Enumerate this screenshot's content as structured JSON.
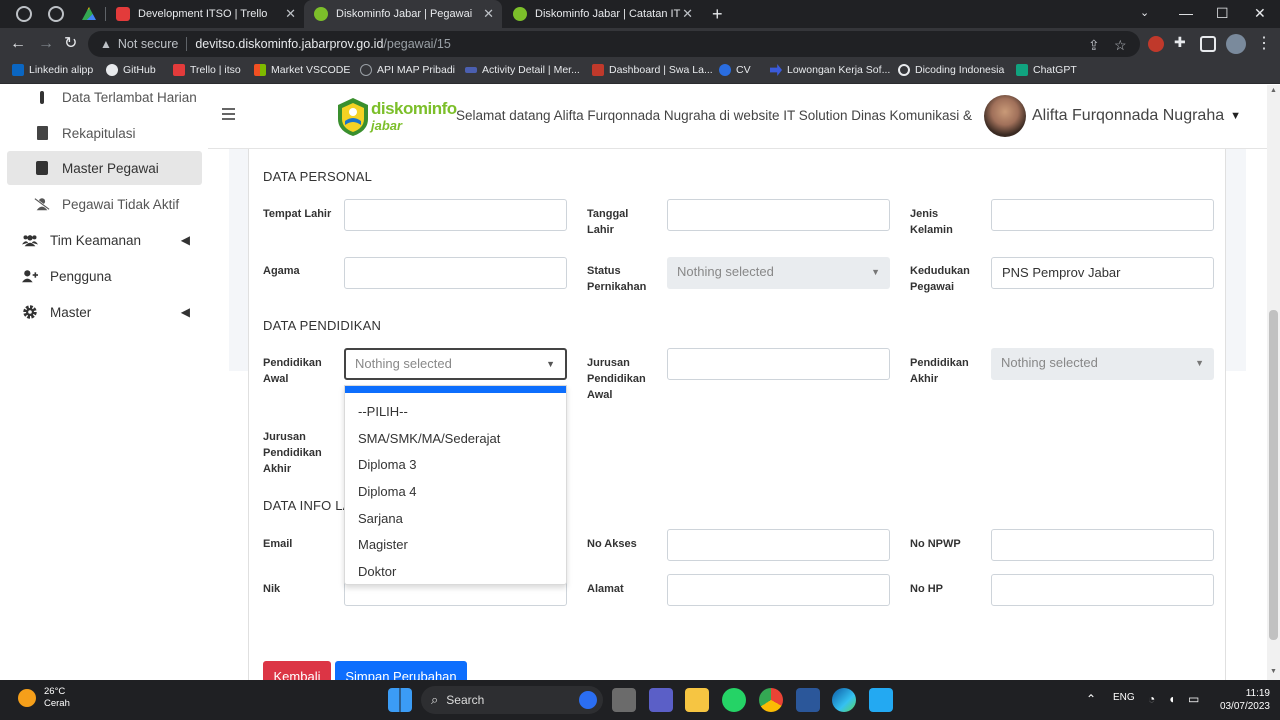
{
  "browser": {
    "tabs": [
      {
        "title": "Development ITSO | Trello",
        "active": false
      },
      {
        "title": "Diskominfo Jabar | Pegawai",
        "active": true
      },
      {
        "title": "Diskominfo Jabar | Catatan IT",
        "active": false
      }
    ],
    "security_label": "Not secure",
    "url_host": "devitso.diskominfo.jabarprov.go.id",
    "url_path": "/pegawai/15",
    "bookmarks": [
      "Linkedin alipp",
      "GitHub",
      "Trello | itso",
      "Market VSCODE",
      "API MAP Pribadi",
      "Activity Detail | Mer...",
      "Dashboard | Swa La...",
      "CV",
      "Lowongan Kerja Sof...",
      "Dicoding Indonesia",
      "ChatGPT"
    ]
  },
  "sidebar": {
    "items": [
      {
        "label": "Data Terlambat Harian",
        "icon": "exclamation-icon"
      },
      {
        "label": "Rekapitulasi",
        "icon": "file-icon"
      },
      {
        "label": "Master Pegawai",
        "icon": "id-card-icon"
      },
      {
        "label": "Pegawai Tidak Aktif",
        "icon": "user-slash-icon"
      },
      {
        "label": "Tim Keamanan",
        "icon": "users-icon"
      },
      {
        "label": "Pengguna",
        "icon": "user-plus-icon"
      },
      {
        "label": "Master",
        "icon": "gear-icon"
      }
    ]
  },
  "header": {
    "logo_text_top": "diskominfo",
    "logo_text_bottom": "jabar",
    "welcome": "Selamat datang Alifta Furqonnada Nugraha di website IT Solution Dinas Komunikasi & In",
    "user_name": "Alifta Furqonnada Nugraha"
  },
  "form": {
    "personal": {
      "title": "DATA PERSONAL",
      "tempat_lahir_label": "Tempat Lahir",
      "tanggal_lahir_label": "Tanggal Lahir",
      "jenis_kelamin_label": "Jenis Kelamin",
      "agama_label": "Agama",
      "status_pernikahan_label": "Status Pernikahan",
      "status_pernikahan_value": "Nothing selected",
      "kedudukan_label": "Kedudukan Pegawai",
      "kedudukan_value": "PNS Pemprov Jabar"
    },
    "pendidikan": {
      "title": "DATA PENDIDIKAN",
      "awal_label": "Pendidikan Awal",
      "awal_value": "Nothing selected",
      "jurusan_awal_label": "Jurusan Pendidikan Awal",
      "akhir_label": "Pendidikan Akhir",
      "akhir_value": "Nothing selected",
      "jurusan_akhir_label": "Jurusan Pendidikan Akhir",
      "options": [
        "--PILIH--",
        "SMA/SMK/MA/Sederajat",
        "Diploma 3",
        "Diploma 4",
        "Sarjana",
        "Magister",
        "Doktor"
      ]
    },
    "info": {
      "title": "DATA INFO LA",
      "email_label": "Email",
      "no_akses_label": "No Akses",
      "no_npwp_label": "No NPWP",
      "nik_label": "Nik",
      "alamat_label": "Alamat",
      "no_hp_label": "No HP"
    },
    "buttons": {
      "back": "Kembali",
      "save": "Simpan Perubahan"
    }
  },
  "taskbar": {
    "temperature": "26°C",
    "weather": "Cerah",
    "search": "Search",
    "language": "ENG",
    "time": "11:19",
    "date": "03/07/2023"
  },
  "colors": {
    "primary": "#0d6efd",
    "danger": "#dc3545",
    "logo_green": "#7cbf2a",
    "logo_blue": "#1a73c9"
  }
}
